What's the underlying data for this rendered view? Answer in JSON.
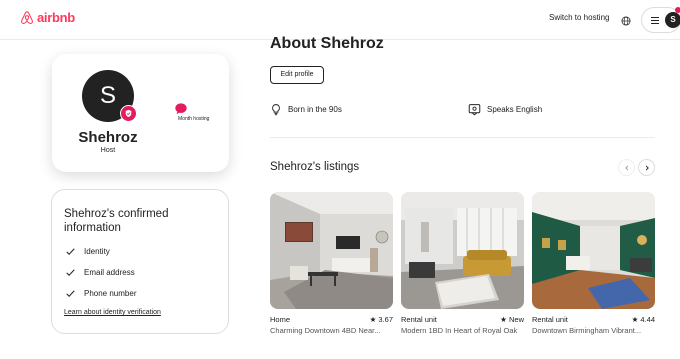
{
  "header": {
    "logo_text": "airbnb",
    "switch_label": "Switch to hosting",
    "avatar_initial": "S",
    "notification_count": "1"
  },
  "profile": {
    "initial": "S",
    "name": "Shehroz",
    "role": "Host",
    "month_label": "Month hosting"
  },
  "confirmed": {
    "title": "Shehroz's confirmed information",
    "items": [
      {
        "label": "Identity"
      },
      {
        "label": "Email address"
      },
      {
        "label": "Phone number"
      }
    ],
    "link": "Learn about identity verification"
  },
  "about": {
    "title": "About Shehroz",
    "edit_label": "Edit profile",
    "facts": [
      {
        "label": "Born in the 90s",
        "icon": "lightbulb-icon"
      },
      {
        "label": "Speaks English",
        "icon": "speech-icon"
      }
    ]
  },
  "listings": {
    "title": "Shehroz's listings",
    "items": [
      {
        "type": "Home",
        "rating": "3.67",
        "title": "Charming Downtown 4BD Near..."
      },
      {
        "type": "Rental unit",
        "rating": "New",
        "title": "Modern 1BD In Heart of Royal Oak"
      },
      {
        "type": "Rental unit",
        "rating": "4.44",
        "title": "Downtown Birmingham Vibrant..."
      }
    ]
  },
  "colors": {
    "brand": "#ff385c",
    "badge": "#e31c5f",
    "text": "#222222"
  }
}
